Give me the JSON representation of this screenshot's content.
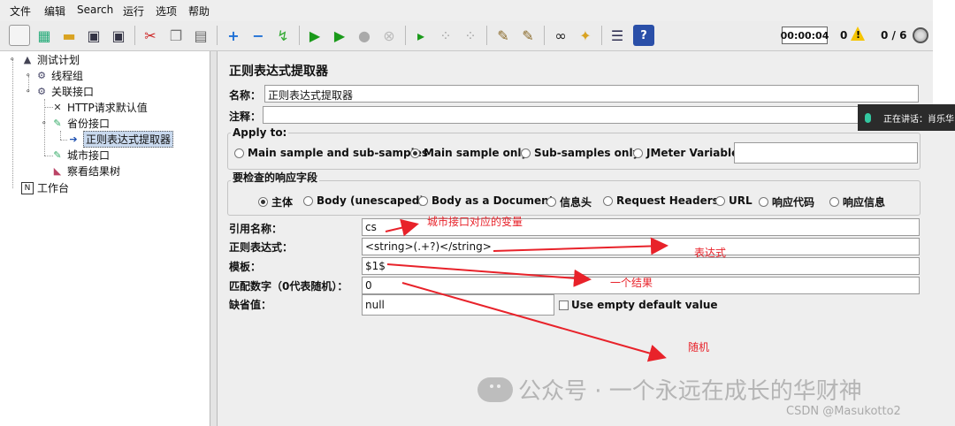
{
  "menu": [
    "文件",
    "编辑",
    "Search",
    "运行",
    "选项",
    "帮助"
  ],
  "toolbar": {
    "icons": [
      "new-icon",
      "templates-icon",
      "open-icon",
      "save-icon",
      "save-as-icon",
      "cut-icon",
      "copy-icon",
      "paste-icon",
      "expand-icon",
      "collapse-icon",
      "toggle-icon",
      "start-icon",
      "start-no-pause-icon",
      "stop-icon",
      "shutdown-icon",
      "remote-start-icon",
      "remote-stop-icon",
      "remote-shutdown-icon",
      "clear-icon",
      "clear-all-icon",
      "search-icon",
      "reset-search-icon",
      "function-helper-icon",
      "help-icon"
    ],
    "timer": "00:00:04",
    "warnings": "0",
    "threads": "0 / 6"
  },
  "tree": {
    "items": [
      {
        "label": "测试计划",
        "icon": "test-plan-icon"
      },
      {
        "label": "线程组",
        "icon": "thread-group-icon"
      },
      {
        "label": "关联接口",
        "icon": "thread-group-icon"
      },
      {
        "label": "HTTP请求默认值",
        "icon": "config-wrench-icon"
      },
      {
        "label": "省份接口",
        "icon": "sampler-icon"
      },
      {
        "label": "正则表达式提取器",
        "icon": "extractor-icon"
      },
      {
        "label": "城市接口",
        "icon": "sampler-icon"
      },
      {
        "label": "察看结果树",
        "icon": "listener-icon"
      },
      {
        "label": "工作台",
        "icon": "workbench-icon"
      }
    ]
  },
  "panel": {
    "title": "正则表达式提取器",
    "name_label": "名称：",
    "name_value": "正则表达式提取器",
    "comment_label": "注释：",
    "comment_value": "",
    "apply_to": {
      "title": "Apply to:",
      "options": [
        "Main sample and sub-samples",
        "Main sample only",
        "Sub-samples only",
        "JMeter Variable"
      ],
      "selected": "Main sample only",
      "variable_value": ""
    },
    "response_field": {
      "title": "要检查的响应字段",
      "options": [
        "主体",
        "Body (unescaped)",
        "Body as a Document",
        "信息头",
        "Request Headers",
        "URL",
        "响应代码",
        "响应信息"
      ],
      "selected": "主体"
    },
    "ref_name_label": "引用名称：",
    "ref_name_value": "cs",
    "regex_label": "正则表达式：",
    "regex_value": "<string>(.+?)</string>",
    "template_label": "模板：",
    "template_value": "$1$",
    "match_no_label": "匹配数字（0代表随机）：",
    "match_no_value": "0",
    "default_label": "缺省值：",
    "default_value": "null",
    "use_empty_label": "Use empty default value"
  },
  "annotations": {
    "ref_name": "城市接口对应的变量",
    "regex": "表达式",
    "template": "一个结果",
    "match_no": "随机",
    "color": "#e8222a"
  },
  "overlay": {
    "text": "正在讲话：肖乐华"
  },
  "watermark": "公众号 · 一个永远在成长的华财神",
  "csdn": "CSDN @Masukotto2"
}
